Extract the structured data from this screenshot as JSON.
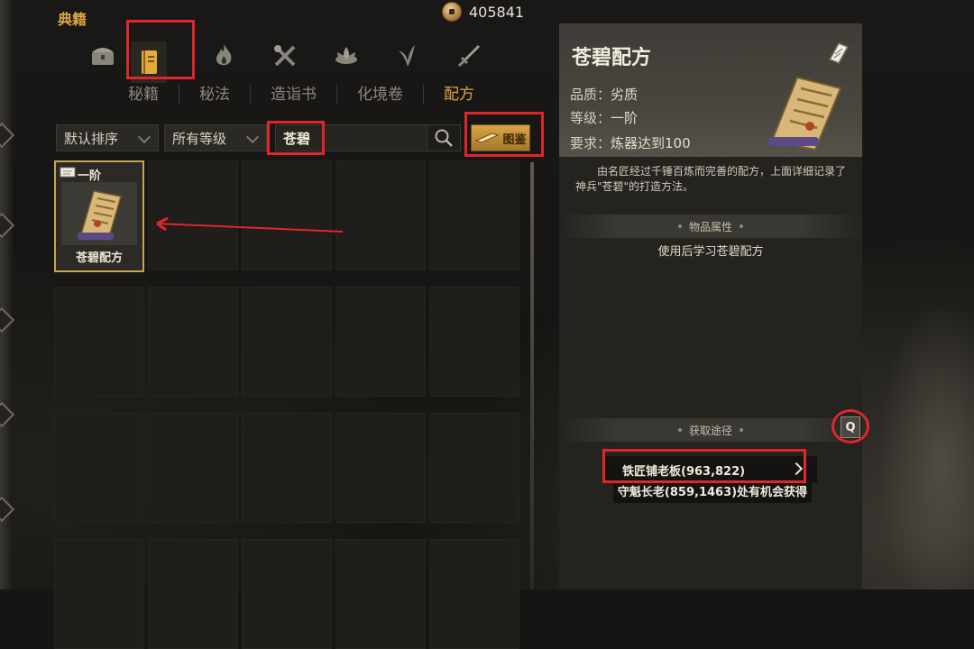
{
  "window": {
    "title": "典籍"
  },
  "currency": {
    "icon": "coin-icon",
    "value": "405841"
  },
  "category_icons": [
    {
      "name": "chest-icon"
    },
    {
      "name": "book-icon",
      "active": true
    },
    {
      "name": "flame-icon"
    },
    {
      "name": "crossed-tools-icon"
    },
    {
      "name": "lotus-icon"
    },
    {
      "name": "herb-icon"
    },
    {
      "name": "sword-icon"
    }
  ],
  "subtabs": [
    "秘籍",
    "秘法",
    "造诣书",
    "化境卷",
    "配方"
  ],
  "active_subtab": "配方",
  "filters": {
    "sort": "默认排序",
    "grade": "所有等级",
    "search_value": "苍碧",
    "atlas_button": "图鉴"
  },
  "grid": {
    "items": [
      {
        "grade": "一阶",
        "name": "苍碧配方",
        "selected": true
      }
    ]
  },
  "detail": {
    "title": "苍碧配方",
    "quality_label": "品质：",
    "quality_value": "劣质",
    "grade_label": "等级：",
    "grade_value": "一阶",
    "req_label": "要求：",
    "req_value": "炼器达到100",
    "description": "由名匠经过千锤百炼而完善的配方，上面详细记录了神兵\"苍碧\"的打造方法。",
    "section_attr": "物品属性",
    "attr_text": "使用后学习苍碧配方",
    "section_source": "获取途径",
    "source_1": "铁匠铺老板(963,822)",
    "source_2": "守魁长老(859,1463)处有机会获得",
    "hotkey": "Q"
  },
  "colors": {
    "accent": "#d9a441",
    "highlight_box": "#e0262b",
    "item_border": "#c8a455"
  }
}
